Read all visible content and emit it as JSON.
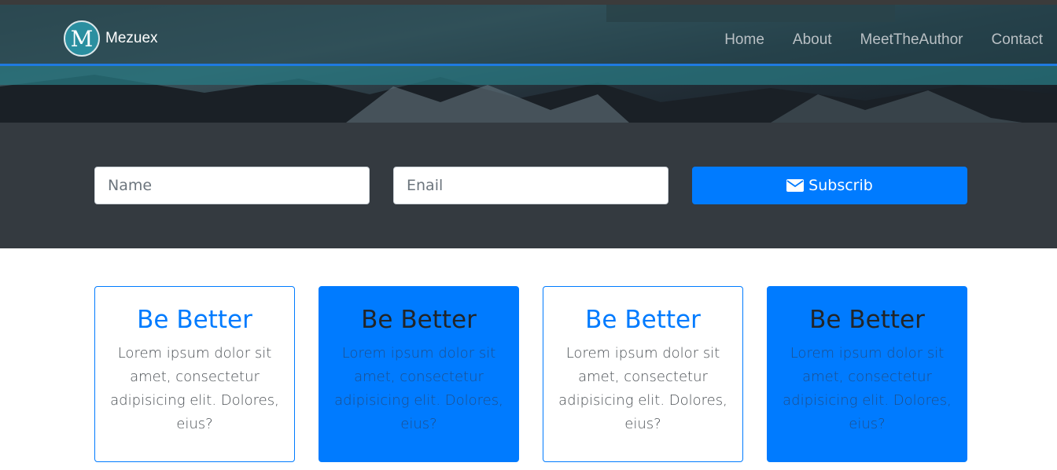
{
  "navbar": {
    "brand": "Mezuex",
    "logo_letter": "M",
    "links": [
      "Home",
      "About",
      "MeetTheAuthor",
      "Contact"
    ]
  },
  "subscribe": {
    "name_placeholder": "Name",
    "email_placeholder": "Enail",
    "button_label": "Subscrib",
    "button_icon": "envelope-icon"
  },
  "cards": [
    {
      "title": "Be Better",
      "text": "Lorem ipsum dolor sit amet, consectetur adipisicing elit. Dolores, eius?"
    },
    {
      "title": "Be Better",
      "text": "Lorem ipsum dolor sit amet, consectetur adipisicing elit. Dolores, eius?"
    },
    {
      "title": "Be Better",
      "text": "Lorem ipsum dolor sit amet, consectetur adipisicing elit. Dolores, eius?"
    },
    {
      "title": "Be Better",
      "text": "Lorem ipsum dolor sit amet, consectetur adipisicing elit. Dolores, eius?"
    }
  ],
  "colors": {
    "accent": "#007bff",
    "dark_section": "#343a40",
    "nav_link": "#b9c0c4"
  }
}
